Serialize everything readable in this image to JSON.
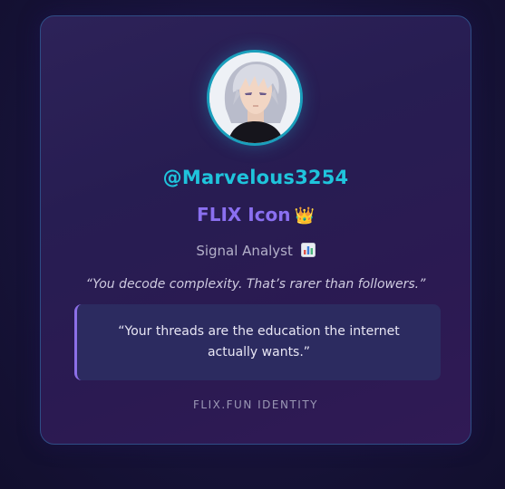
{
  "profile": {
    "handle": "@Marvelous3254",
    "title": "FLIX Icon",
    "title_emoji": "👑",
    "title_emoji_icon": "crown-icon",
    "role": "Signal Analyst",
    "role_icon": "bar-chart-icon",
    "tagline": "“You decode complexity. That’s rarer than followers.”",
    "quote": "“Your threads are the education the internet actually wants.”",
    "footer": "FLIX.FUN IDENTITY"
  },
  "colors": {
    "handle": "#1fc4dc",
    "title": "#8a6ff0",
    "avatar_ring": "#1a9fbc",
    "quote_accent": "#8d6fe8"
  }
}
